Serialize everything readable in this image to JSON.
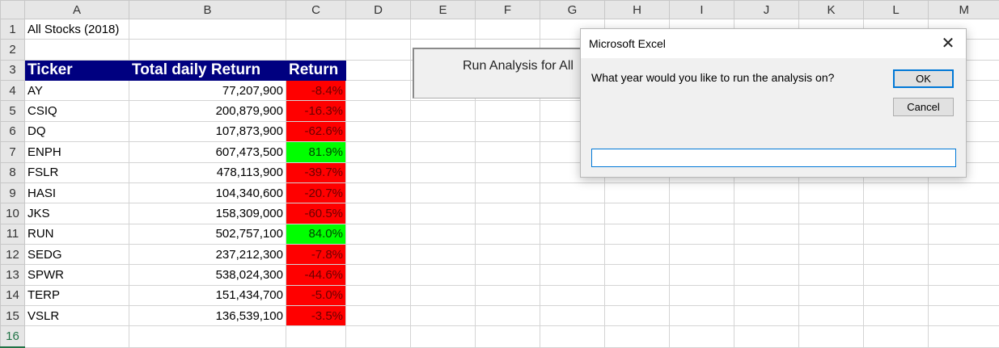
{
  "sheet": {
    "columns": [
      "A",
      "B",
      "C",
      "D",
      "E",
      "F",
      "G",
      "H",
      "I",
      "J",
      "K",
      "L",
      "M"
    ],
    "row_numbers": [
      "1",
      "2",
      "3",
      "4",
      "5",
      "6",
      "7",
      "8",
      "9",
      "10",
      "11",
      "12",
      "13",
      "14",
      "15",
      "16"
    ],
    "title": "All Stocks (2018)",
    "headers": {
      "ticker": "Ticker",
      "total_volume": "Total daily Return",
      "return": "Return"
    },
    "rows": [
      {
        "ticker": "AY",
        "volume": "77,207,900",
        "return": "-8.4%",
        "status": "neg"
      },
      {
        "ticker": "CSIQ",
        "volume": "200,879,900",
        "return": "-16.3%",
        "status": "neg"
      },
      {
        "ticker": "DQ",
        "volume": "107,873,900",
        "return": "-62.6%",
        "status": "neg"
      },
      {
        "ticker": "ENPH",
        "volume": "607,473,500",
        "return": "81.9%",
        "status": "pos"
      },
      {
        "ticker": "FSLR",
        "volume": "478,113,900",
        "return": "-39.7%",
        "status": "neg"
      },
      {
        "ticker": "HASI",
        "volume": "104,340,600",
        "return": "-20.7%",
        "status": "neg"
      },
      {
        "ticker": "JKS",
        "volume": "158,309,000",
        "return": "-60.5%",
        "status": "neg"
      },
      {
        "ticker": "RUN",
        "volume": "502,757,100",
        "return": "84.0%",
        "status": "pos"
      },
      {
        "ticker": "SEDG",
        "volume": "237,212,300",
        "return": "-7.8%",
        "status": "neg"
      },
      {
        "ticker": "SPWR",
        "volume": "538,024,300",
        "return": "-44.6%",
        "status": "neg"
      },
      {
        "ticker": "TERP",
        "volume": "151,434,700",
        "return": "-5.0%",
        "status": "neg"
      },
      {
        "ticker": "VSLR",
        "volume": "136,539,100",
        "return": "-3.5%",
        "status": "neg"
      }
    ]
  },
  "run_button": {
    "label": "Run Analysis for All"
  },
  "dialog": {
    "title": "Microsoft Excel",
    "prompt": "What year would you like to run the analysis on?",
    "ok_label": "OK",
    "cancel_label": "Cancel",
    "input_value": "",
    "close_glyph": "✕"
  },
  "colors": {
    "header_bg": "#000080",
    "negative": "#ff0000",
    "positive": "#00ff00",
    "focus_blue": "#0078d7"
  }
}
